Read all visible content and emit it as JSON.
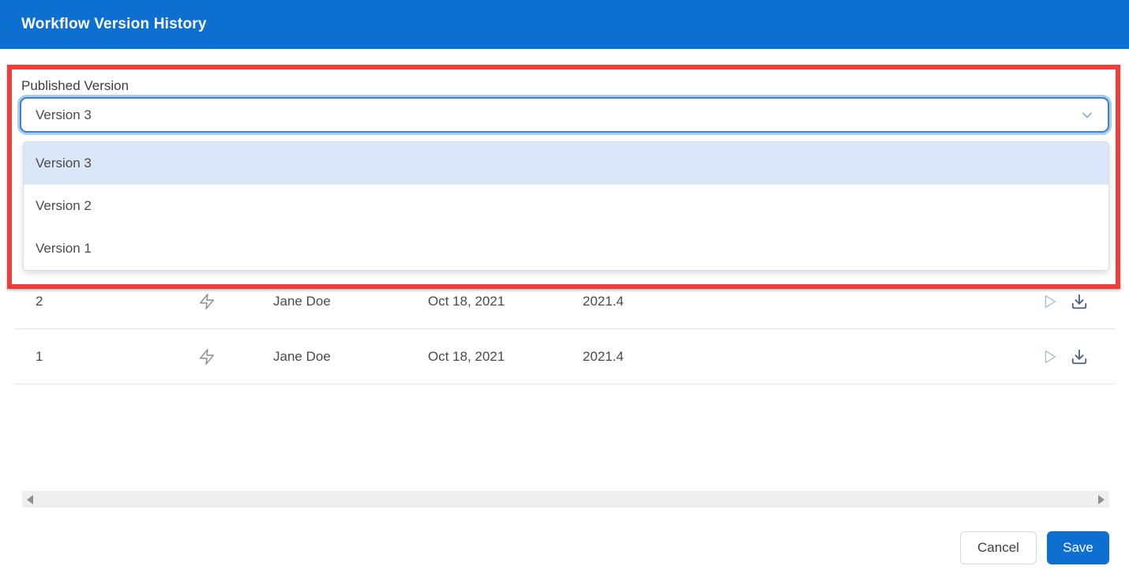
{
  "header": {
    "title": "Workflow Version History"
  },
  "published_version": {
    "label": "Published Version",
    "selected_value": "Version 3",
    "options": [
      {
        "label": "Version 3",
        "selected": true
      },
      {
        "label": "Version 2",
        "selected": false
      },
      {
        "label": "Version 1",
        "selected": false
      }
    ]
  },
  "version_table": {
    "rows": [
      {
        "version": "2",
        "type_icon": "zap-icon",
        "author": "Jane Doe",
        "date": "Oct 18, 2021",
        "release": "2021.4",
        "actions": [
          "play-icon",
          "download-icon"
        ]
      },
      {
        "version": "1",
        "type_icon": "zap-icon",
        "author": "Jane Doe",
        "date": "Oct 18, 2021",
        "release": "2021.4",
        "actions": [
          "play-icon",
          "download-icon"
        ]
      }
    ]
  },
  "footer": {
    "cancel_label": "Cancel",
    "save_label": "Save"
  },
  "colors": {
    "header_bg": "#0d70d1",
    "save_button_bg": "#0d70d1",
    "option_highlight_bg": "#d9e7f8",
    "annotation_red": "#ee3e3a",
    "select_border_focus": "#3d82c8"
  }
}
